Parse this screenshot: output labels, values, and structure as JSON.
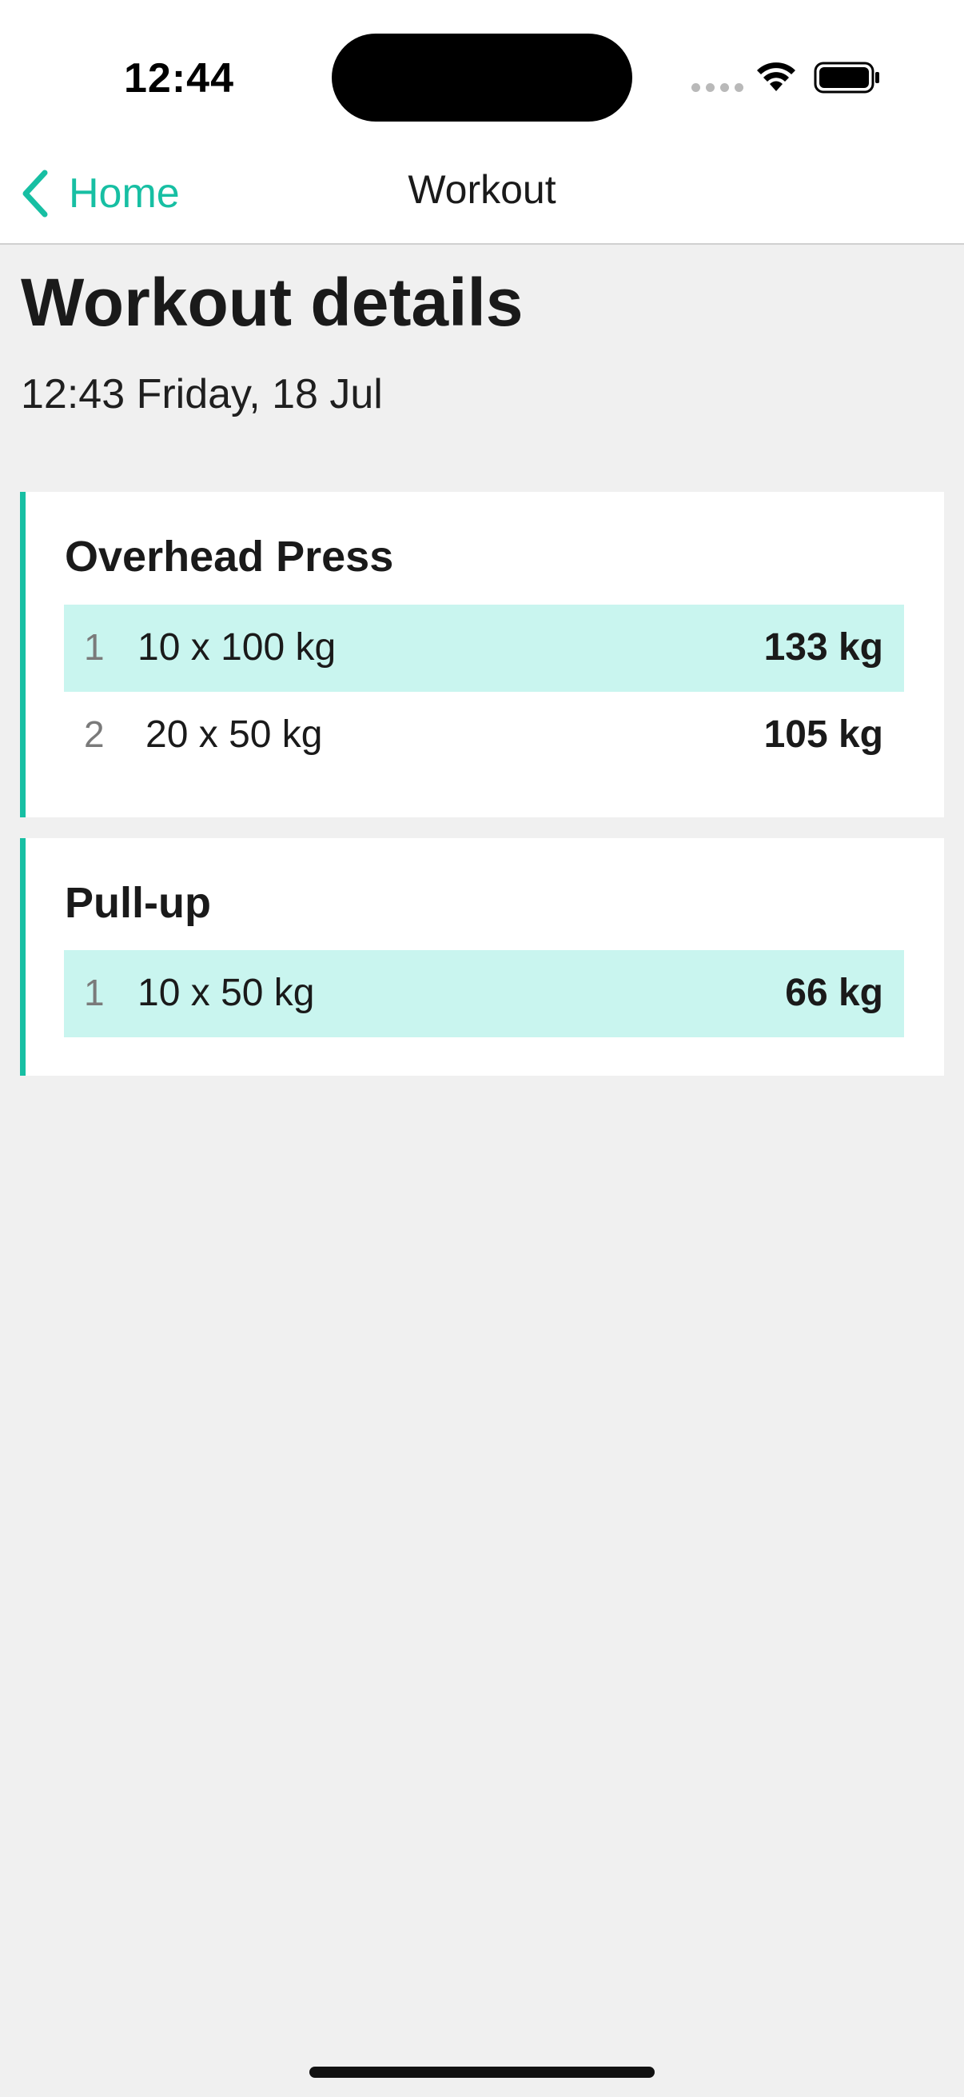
{
  "status_bar": {
    "time": "12:44"
  },
  "nav": {
    "back_label": "Home",
    "title": "Workout",
    "accent_color": "#17bfa3"
  },
  "page": {
    "title": "Workout details",
    "subtitle": "12:43 Friday, 18 Jul"
  },
  "exercises": [
    {
      "name": "Overhead Press",
      "sets": [
        {
          "number": "1",
          "reps": "10 x 100 kg",
          "total": "133 kg",
          "highlighted": true
        },
        {
          "number": "2",
          "reps": "20 x 50 kg",
          "total": "105 kg",
          "highlighted": false
        }
      ]
    },
    {
      "name": "Pull-up",
      "sets": [
        {
          "number": "1",
          "reps": "10 x 50 kg",
          "total": "66 kg",
          "highlighted": true
        }
      ]
    }
  ],
  "colors": {
    "accent": "#17bfa3",
    "highlight_row": "#c9f5ef",
    "background": "#f0f0f0"
  },
  "icons": {
    "back": "chevron-left-icon",
    "wifi": "wifi-icon",
    "battery": "battery-icon",
    "signal": "signal-dots-icon"
  }
}
